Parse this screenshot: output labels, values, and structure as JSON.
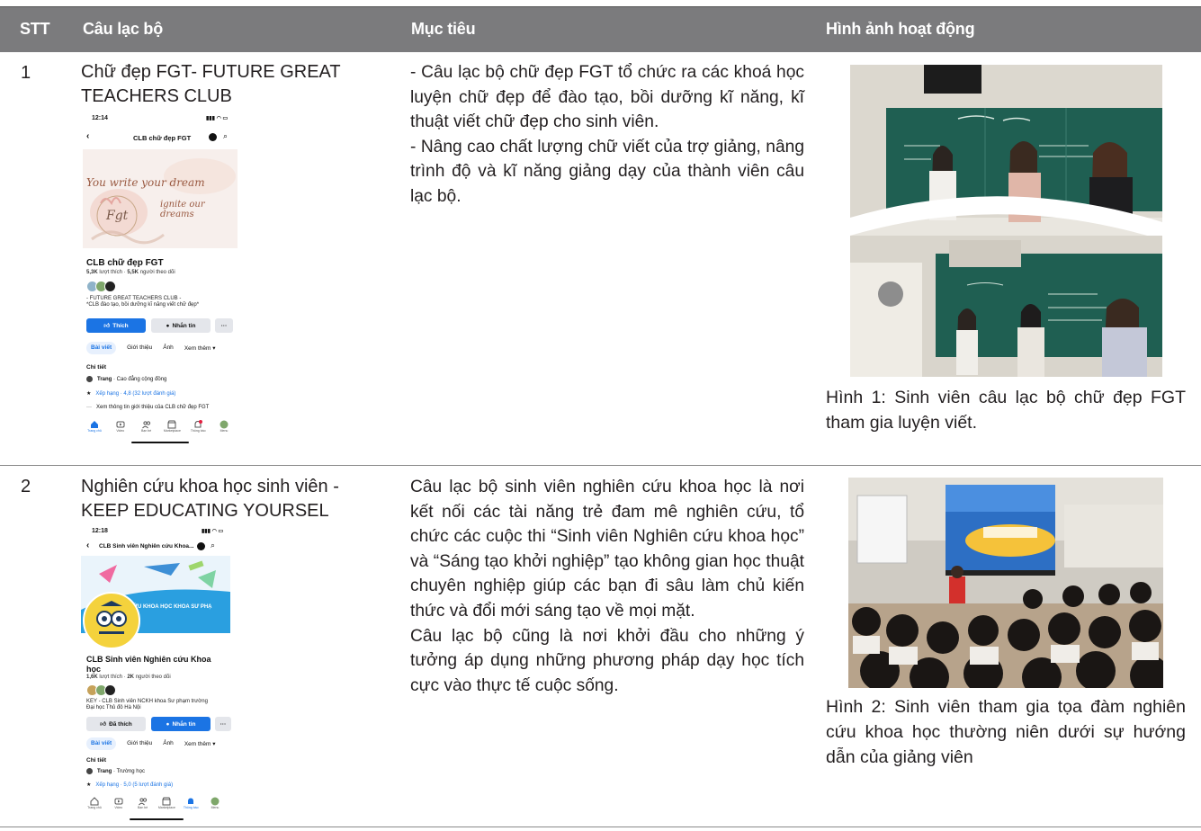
{
  "table": {
    "headers": {
      "stt": "STT",
      "club": "Câu lạc bộ",
      "goal": "Mục tiêu",
      "image": "Hình ảnh hoạt động"
    },
    "rows": [
      {
        "stt": "1",
        "club_line1": "Chữ đẹp FGT- FUTURE GREAT",
        "club_line2": "TEACHERS CLUB",
        "goal_p1": "- Câu lạc bộ chữ đẹp FGT tổ chức ra các khoá học luyện chữ đẹp để đào tạo, bồi dưỡng kĩ năng, kĩ thuật viết chữ đẹp cho sinh viên.",
        "goal_p2": "- Nâng cao chất lượng chữ viết của trợ giảng, nâng trình độ và kĩ năng giảng dạy của thành viên câu lạc bộ.",
        "caption": "Hình 1: Sinh viên câu lạc bộ chữ đẹp FGT tham gia luyện viết.",
        "phone": {
          "time": "12:14",
          "nav_title": "CLB chữ đẹp FGT",
          "cover_line1": "You write your dream",
          "cover_line2": "ignite our dreams",
          "cover_logo": "Fgt",
          "page_name": "CLB chữ đẹp FGT",
          "stats_likes": "5,3K",
          "stats_likes_label": "lượt thích",
          "stats_follow": "5,5K",
          "stats_follow_label": "người theo dõi",
          "desc_line1": "- FUTURE GREAT TEACHERS CLUB -",
          "desc_line2": "*CLB đào tạo, bồi dưỡng kĩ năng viết chữ đẹp*",
          "btn_like": "Thích",
          "btn_message": "Nhắn tin",
          "btn_more": "···",
          "tab_posts": "Bài viết",
          "tab_about": "Giới thiệu",
          "tab_photos": "Ảnh",
          "tab_more": "Xem thêm ▾",
          "section": "Chi tiết",
          "detail1_bold": "Trang",
          "detail1_rest": "· Cao đẳng cộng đồng",
          "detail2": "Xếp hạng · 4,8 (32 lượt đánh giá)",
          "detail3": "Xem thông tin giới thiệu của CLB chữ đẹp FGT",
          "nav_items": [
            "Trang chủ",
            "Video",
            "Bạn bè",
            "Marketplace",
            "Thông báo",
            "Menu"
          ]
        }
      },
      {
        "stt": "2",
        "club_line1": "Nghiên cứu khoa học sinh viên -",
        "club_line2": "KEEP EDUCATING YOURSEL",
        "goal_p1": "Câu lạc bộ sinh viên nghiên cứu khoa học là nơi kết nối các tài năng trẻ đam mê nghiên cứu, tổ chức các cuộc thi “Sinh viên Nghiên cứu khoa học” và “Sáng tạo khởi nghiệp” tạo không gian học thuật chuyên nghiệp giúp các bạn đi sâu làm chủ kiến thức và đổi mới sáng tạo về mọi mặt.",
        "goal_p2": "Câu lạc bộ cũng là nơi khởi đầu cho những ý tưởng áp dụng những phương pháp dạy học tích cực vào thực tế cuộc sống.",
        "caption": "Hình 2: Sinh viên tham gia tọa đàm nghiên cứu khoa học thường niên dưới sự hướng dẫn của giảng viên",
        "phone": {
          "time": "12:18",
          "nav_title": "CLB Sinh viên Nghiên cứu Khoa...",
          "cover_text": "ỨU KHOA HỌC KHOA SƯ PHẠ",
          "page_name_line1": "CLB Sinh viên Nghiên cứu Khoa",
          "page_name_line2": "học",
          "stats_likes": "1,6K",
          "stats_likes_label": "lượt thích",
          "stats_follow": "2K",
          "stats_follow_label": "người theo dõi",
          "desc_line1": "KEY - CLB Sinh viên NCKH khoa Sư phạm trường",
          "desc_line2": "Đại học Thủ đô Hà Nội",
          "btn_like": "Đã thích",
          "btn_message": "Nhắn tin",
          "btn_more": "···",
          "tab_posts": "Bài viết",
          "tab_about": "Giới thiệu",
          "tab_photos": "Ảnh",
          "tab_more": "Xem thêm ▾",
          "section": "Chi tiết",
          "detail1_bold": "Trang",
          "detail1_rest": "· Trường học",
          "detail2": "Xếp hạng · 5,0 (5 lượt đánh giá)",
          "nav_items": [
            "Trang chủ",
            "Video",
            "Bạn bè",
            "Marketplace",
            "Thông báo",
            "Menu"
          ]
        }
      }
    ]
  },
  "colors": {
    "header_bg": "#7b7b7d",
    "fb_blue": "#1b74e4",
    "chalkboard": "#1f5f52"
  }
}
